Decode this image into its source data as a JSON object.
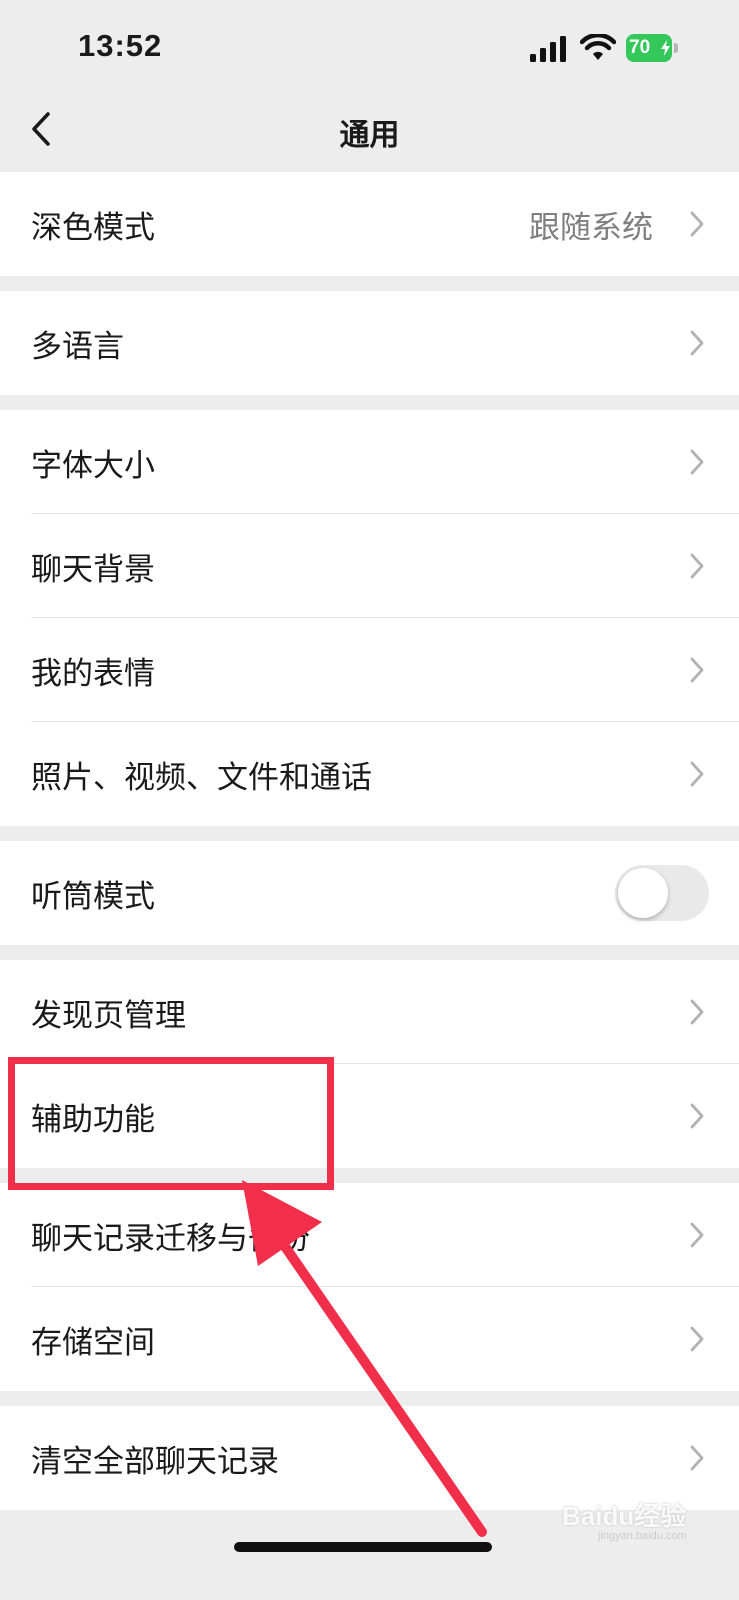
{
  "status_bar": {
    "time": "13:52",
    "battery": "70"
  },
  "nav": {
    "title": "通用"
  },
  "groups": [
    {
      "items": [
        {
          "label": "深色模式",
          "value": "跟随系统"
        }
      ]
    },
    {
      "items": [
        {
          "label": "多语言"
        }
      ]
    },
    {
      "items": [
        {
          "label": "字体大小"
        },
        {
          "label": "聊天背景"
        },
        {
          "label": "我的表情"
        },
        {
          "label": "照片、视频、文件和通话"
        }
      ]
    },
    {
      "items": [
        {
          "label": "听筒模式",
          "toggle": false
        }
      ]
    },
    {
      "items": [
        {
          "label": "发现页管理"
        },
        {
          "label": "辅助功能"
        }
      ]
    },
    {
      "items": [
        {
          "label": "聊天记录迁移与备份"
        },
        {
          "label": "存储空间"
        }
      ]
    },
    {
      "items": [
        {
          "label": "清空全部聊天记录"
        }
      ]
    }
  ],
  "annotation": {
    "highlight_color": "#f22f4a"
  },
  "watermark": {
    "text": "Baidu经验",
    "sub": "jingyan.baidu.com"
  },
  "colors": {
    "toggle_on": "#34c759",
    "toggle_off": "#e9e9ea"
  }
}
